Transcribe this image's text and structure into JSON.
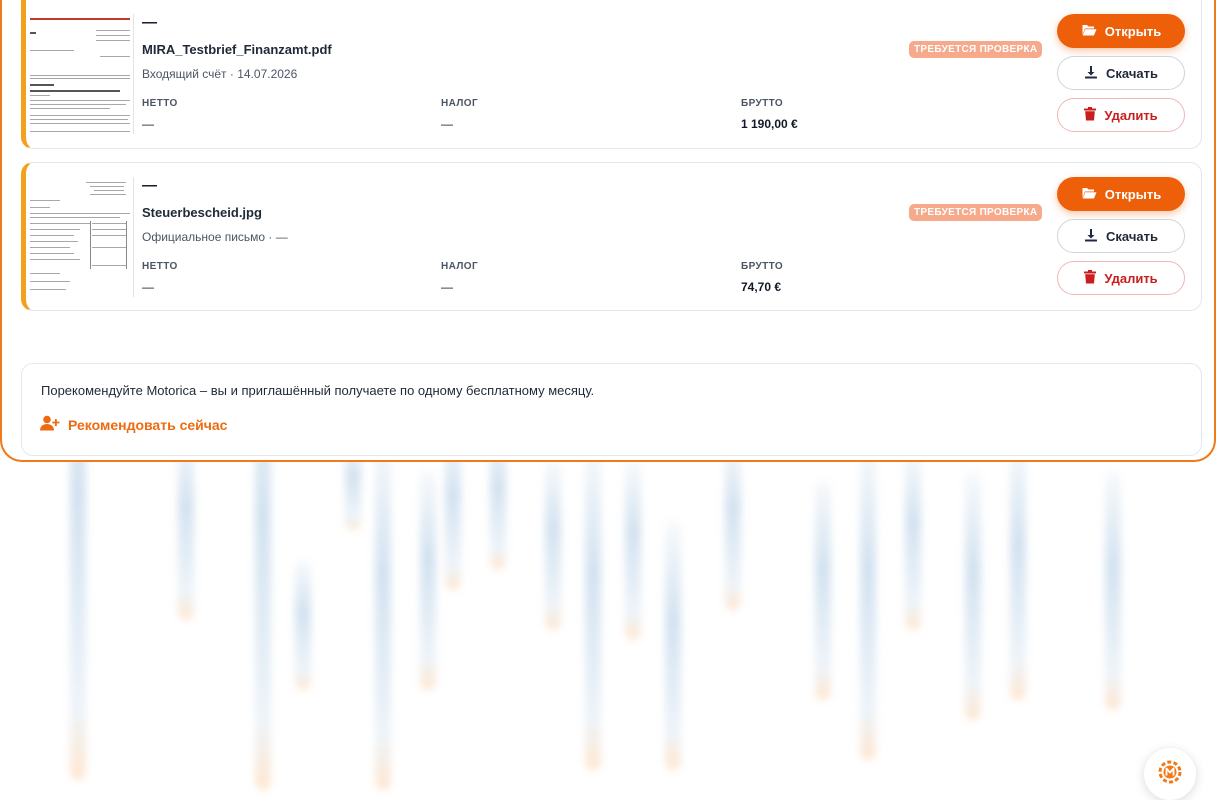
{
  "documents": [
    {
      "dash": "—",
      "filename": "MIRA_Testbrief_Finanzamt.pdf",
      "subtitle": "Входящий счёт · 14.07.2026",
      "badge": "ТРЕБУЕТСЯ ПРОВЕРКА",
      "netto_label": "НЕТТО",
      "netto_value": "—",
      "tax_label": "НАЛОГ",
      "tax_value": "—",
      "brutto_label": "БРУТТО",
      "brutto_value": "1 190,00 €",
      "open_label": "Открыть",
      "download_label": "Скачать",
      "delete_label": "Удалить"
    },
    {
      "dash": "—",
      "filename": "Steuerbescheid.jpg",
      "subtitle": "Официальное письмо · —",
      "badge": "ТРЕБУЕТСЯ ПРОВЕРКА",
      "netto_label": "НЕТТО",
      "netto_value": "—",
      "tax_label": "НАЛОГ",
      "tax_value": "—",
      "brutto_label": "БРУТТО",
      "brutto_value": "74,70 €",
      "open_label": "Открыть",
      "download_label": "Скачать",
      "delete_label": "Удалить"
    }
  ],
  "referral": {
    "text": "Порекомендуйте Motorica – вы и приглашённый получаете по одному бесплатному месяцу.",
    "link_label": "Рекомендовать сейчас"
  },
  "icons": {
    "open": "folder-open-icon",
    "download": "download-icon",
    "delete": "trash-icon",
    "referral": "user-plus-icon",
    "fab": "motorica-logo-icon"
  },
  "colors": {
    "accent": "#ee5f0a",
    "card_stripe": "#f2a11f",
    "badge_bg": "#f7a98b",
    "delete_text": "#c81e1e"
  }
}
